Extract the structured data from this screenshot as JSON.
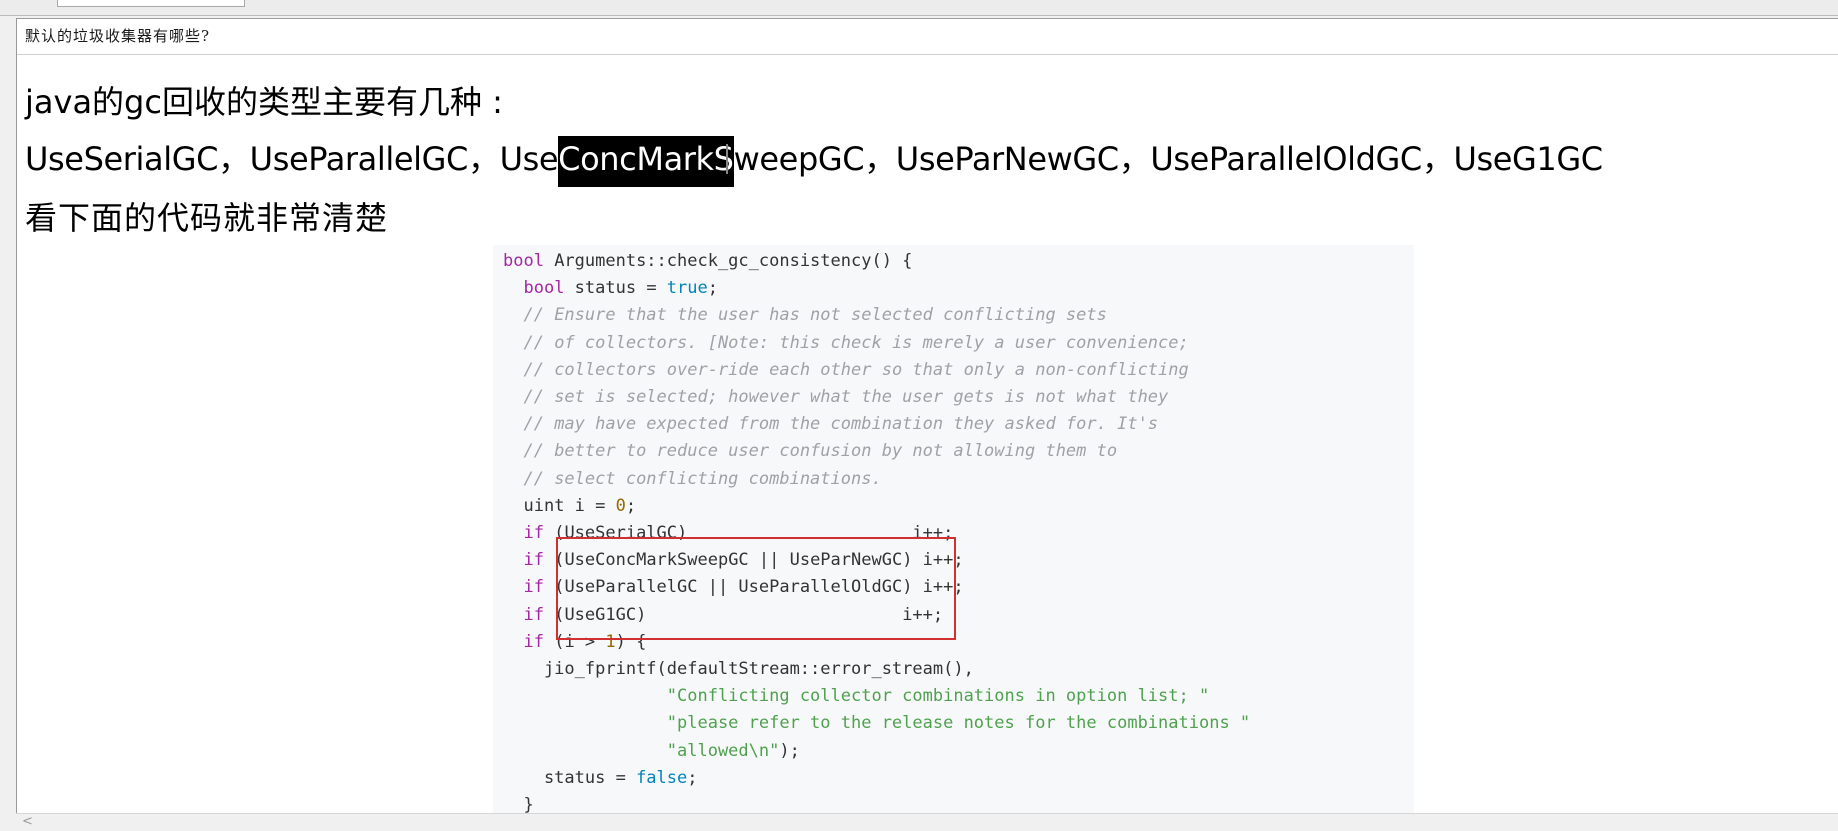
{
  "question": "默认的垃圾收集器有哪些?",
  "heading1": "java的gc回收的类型主要有几种 :",
  "gc_list": {
    "before": "UseSerialGC，UseParallelGC，Use",
    "highlight": "ConcMarkS",
    "after": "weepGC，UseParNewGC，UseParallelOldGC，UseG1GC"
  },
  "heading3": "看下面的代码就非常清楚",
  "code": {
    "l1_kw": "bool",
    "l1_rest": " Arguments::check_gc_consistency() {",
    "l2_kw": "bool",
    "l2_mid": " status = ",
    "l2_val": "true",
    "l2_end": ";",
    "c1": "// Ensure that the user has not selected conflicting sets",
    "c2": "// of collectors. [Note: this check is merely a user convenience;",
    "c3": "// collectors over-ride each other so that only a non-conflicting",
    "c4": "// set is selected; however what the user gets is not what they",
    "c5": "// may have expected from the combination they asked for. It's",
    "c6": "// better to reduce user confusion by not allowing them to",
    "c7": "// select conflicting combinations.",
    "uint_a": "uint i = ",
    "uint_num": "0",
    "uint_b": ";",
    "if_kw": "if",
    "if1": " (UseSerialGC)                      i++;",
    "if2": " (UseConcMarkSweepGC || UseParNewGC) i++;",
    "if3": " (UseParallelGC || UseParallelOldGC) i++;",
    "if4": " (UseG1GC)                         i++;",
    "if5_a": " (i > ",
    "if5_num": "1",
    "if5_b": ") {",
    "jio": "    jio_fprintf(defaultStream::error_stream(),",
    "s1": "\"Conflicting collector combinations in option list; \"",
    "s2": "\"please refer to the release notes for the combinations \"",
    "s3": "\"allowed\\n\"",
    "s3_end": ");",
    "status_a": "    status = ",
    "status_val": "false",
    "status_b": ";",
    "close": "  }"
  },
  "scroll_left_arrow": "<"
}
